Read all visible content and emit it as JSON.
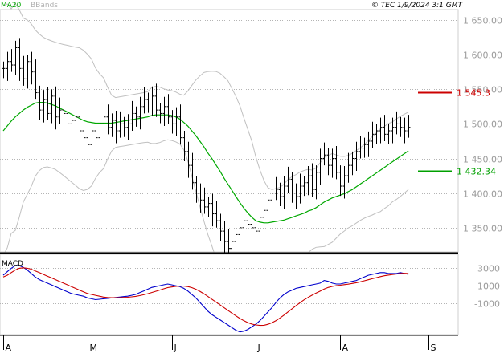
{
  "header": {
    "legend_ma": "MA20",
    "legend_bb": "BBands",
    "copyright": "© TEC 1/9/2024 3:1 GMT"
  },
  "colors": {
    "price": "#000000",
    "ma20": "#00a800",
    "bbands": "#c0c0c0",
    "macd": "#0000cc",
    "signal": "#cc0000",
    "grid": "#b4b4b4",
    "resistance": "#cc0000",
    "support": "#00a000",
    "axis_text": "#9a9a9a"
  },
  "chart_data": [
    {
      "type": "ohlc",
      "y_ticks": [
        "1 650.00",
        "1 600.00",
        "1 550.00",
        "1 500.00",
        "1 450.00",
        "1 400.00",
        "1 350.00"
      ],
      "y_tick_values": [
        1650,
        1600,
        1550,
        1500,
        1450,
        1400,
        1350
      ],
      "ylim": [
        1315,
        1665
      ],
      "x_month_labels": [
        "A",
        "M",
        "J",
        "J",
        "A",
        "S"
      ],
      "x_month_positions": [
        0,
        21,
        42,
        63,
        84,
        106
      ],
      "xlim": [
        0,
        112
      ],
      "levels": [
        {
          "label": "1 545.3",
          "value": 1545.3,
          "kind": "resistance"
        },
        {
          "label": "1 432.34",
          "value": 1432.34,
          "kind": "support"
        }
      ],
      "closes": [
        1580,
        1590,
        1585,
        1610,
        1580,
        1565,
        1590,
        1575,
        1545,
        1520,
        1535,
        1515,
        1540,
        1510,
        1520,
        1515,
        1500,
        1505,
        1510,
        1490,
        1480,
        1470,
        1490,
        1480,
        1500,
        1510,
        1495,
        1505,
        1490,
        1500,
        1495,
        1500,
        1515,
        1510,
        1525,
        1535,
        1530,
        1540,
        1520,
        1515,
        1525,
        1510,
        1500,
        1510,
        1480,
        1460,
        1440,
        1415,
        1400,
        1390,
        1380,
        1385,
        1370,
        1360,
        1345,
        1330,
        1320,
        1330,
        1340,
        1350,
        1360,
        1355,
        1350,
        1345,
        1365,
        1375,
        1390,
        1400,
        1405,
        1395,
        1410,
        1420,
        1400,
        1395,
        1410,
        1415,
        1425,
        1405,
        1430,
        1450,
        1455,
        1440,
        1450,
        1430,
        1410,
        1425,
        1440,
        1450,
        1460,
        1465,
        1470,
        1475,
        1485,
        1490,
        1495,
        1485,
        1490,
        1495,
        1500,
        1495,
        1490,
        1495
      ],
      "ma20": [
        1490,
        1497,
        1504,
        1510,
        1515,
        1520,
        1524,
        1527,
        1530,
        1531,
        1531,
        1530,
        1528,
        1526,
        1523,
        1520,
        1517,
        1514,
        1511,
        1508,
        1505,
        1503,
        1502,
        1501,
        1501,
        1501,
        1501,
        1501,
        1502,
        1503,
        1504,
        1505,
        1506,
        1507,
        1508,
        1509,
        1510,
        1512,
        1513,
        1513,
        1513,
        1513,
        1512,
        1510,
        1507,
        1502,
        1497,
        1490,
        1483,
        1475,
        1467,
        1458,
        1450,
        1441,
        1432,
        1422,
        1413,
        1404,
        1395,
        1386,
        1378,
        1371,
        1365,
        1360,
        1358,
        1357,
        1357,
        1358,
        1359,
        1360,
        1361,
        1363,
        1365,
        1367,
        1369,
        1371,
        1374,
        1376,
        1379,
        1383,
        1387,
        1390,
        1393,
        1395,
        1397,
        1399,
        1402,
        1405,
        1409,
        1413,
        1417,
        1421,
        1425,
        1429,
        1433,
        1437,
        1441,
        1445,
        1449,
        1453,
        1457,
        1461
      ]
    },
    {
      "type": "line",
      "title": "MACD",
      "y_ticks": [
        "3000",
        "1000",
        "-1000"
      ],
      "y_tick_values": [
        3000,
        1000,
        -1000
      ],
      "ylim": [
        -4600,
        4600
      ],
      "series": [
        {
          "role": "macd",
          "values": [
            2200,
            2600,
            3000,
            3300,
            3300,
            3100,
            2800,
            2400,
            2000,
            1700,
            1500,
            1300,
            1100,
            900,
            700,
            500,
            300,
            100,
            0,
            -100,
            -200,
            -400,
            -500,
            -600,
            -550,
            -500,
            -450,
            -400,
            -350,
            -300,
            -250,
            -200,
            -100,
            0,
            200,
            400,
            600,
            800,
            900,
            1000,
            1100,
            1200,
            1100,
            1000,
            900,
            700,
            400,
            0,
            -400,
            -900,
            -1400,
            -1900,
            -2300,
            -2600,
            -2900,
            -3200,
            -3500,
            -3800,
            -4100,
            -4300,
            -4200,
            -4000,
            -3700,
            -3400,
            -3000,
            -2500,
            -2000,
            -1500,
            -900,
            -400,
            0,
            300,
            500,
            700,
            800,
            900,
            1000,
            1100,
            1200,
            1300,
            1600,
            1500,
            1300,
            1200,
            1200,
            1300,
            1400,
            1500,
            1600,
            1800,
            2000,
            2200,
            2300,
            2400,
            2500,
            2500,
            2400,
            2400,
            2400,
            2500,
            2400,
            2300
          ]
        },
        {
          "role": "signal",
          "values": [
            2000,
            2200,
            2500,
            2800,
            3000,
            3050,
            3000,
            2900,
            2700,
            2500,
            2300,
            2100,
            1900,
            1700,
            1500,
            1300,
            1100,
            900,
            700,
            500,
            300,
            100,
            0,
            -100,
            -200,
            -300,
            -350,
            -380,
            -380,
            -370,
            -350,
            -320,
            -280,
            -220,
            -140,
            -40,
            80,
            220,
            360,
            500,
            640,
            780,
            860,
            920,
            960,
            960,
            900,
            780,
            600,
            360,
            80,
            -220,
            -540,
            -860,
            -1180,
            -1500,
            -1820,
            -2140,
            -2460,
            -2760,
            -3020,
            -3240,
            -3400,
            -3500,
            -3550,
            -3530,
            -3420,
            -3240,
            -3000,
            -2700,
            -2360,
            -2000,
            -1640,
            -1280,
            -940,
            -620,
            -340,
            -80,
            160,
            380,
            620,
            800,
            920,
            1000,
            1060,
            1120,
            1180,
            1260,
            1340,
            1440,
            1560,
            1680,
            1800,
            1920,
            2040,
            2140,
            2220,
            2280,
            2340,
            2400,
            2420,
            2400
          ]
        }
      ]
    }
  ]
}
